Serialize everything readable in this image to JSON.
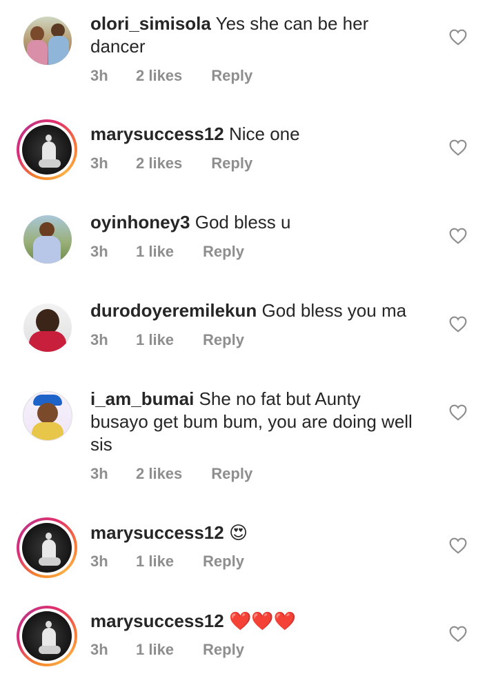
{
  "comments": [
    {
      "username": "olori_simisola",
      "text": "Yes she can be her dancer",
      "time": "3h",
      "likes": "2 likes",
      "reply": "Reply",
      "avatar_style": "plain",
      "avatar_icon": "user-photo-icon"
    },
    {
      "username": "marysuccess12",
      "text": "Nice one",
      "time": "3h",
      "likes": "2 likes",
      "reply": "Reply",
      "avatar_style": "story",
      "avatar_icon": "user-photo-icon"
    },
    {
      "username": "oyinhoney3",
      "text": "God bless u",
      "time": "3h",
      "likes": "1 like",
      "reply": "Reply",
      "avatar_style": "plain",
      "avatar_icon": "user-photo-icon"
    },
    {
      "username": "durodoyeremilekun",
      "text": "God bless you ma",
      "time": "3h",
      "likes": "1 like",
      "reply": "Reply",
      "avatar_style": "plain",
      "avatar_icon": "user-photo-icon"
    },
    {
      "username": "i_am_bumai",
      "text": "She no fat but Aunty busayo get bum bum, you are doing well sis",
      "time": "3h",
      "likes": "2 likes",
      "reply": "Reply",
      "avatar_style": "plain",
      "avatar_icon": "user-photo-icon"
    },
    {
      "username": "marysuccess12",
      "text": "😍",
      "time": "3h",
      "likes": "1 like",
      "reply": "Reply",
      "avatar_style": "story",
      "avatar_icon": "user-photo-icon"
    },
    {
      "username": "marysuccess12",
      "text": "❤️❤️❤️",
      "time": "3h",
      "likes": "1 like",
      "reply": "Reply",
      "avatar_style": "story",
      "avatar_icon": "user-photo-icon"
    }
  ],
  "icons": {
    "like": "heart-outline-icon"
  },
  "colors": {
    "text": "#262626",
    "meta": "#8e8e8e",
    "heart": "#8e8e8e",
    "story_ring": "#dd2a7b"
  }
}
